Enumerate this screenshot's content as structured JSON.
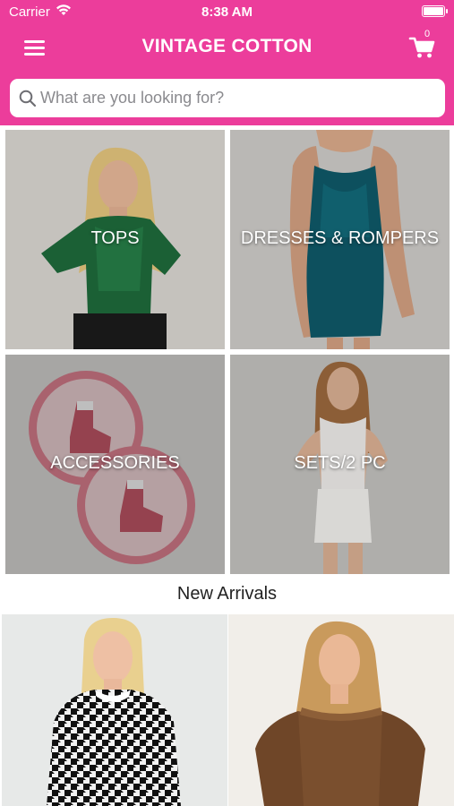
{
  "status_bar": {
    "carrier": "Carrier",
    "time": "8:38 AM"
  },
  "header": {
    "title": "VINTAGE COTTON",
    "cart_count": "0",
    "menu_icon": "hamburger-menu-icon",
    "cart_icon": "shopping-cart-icon"
  },
  "search": {
    "placeholder": "What are you looking for?",
    "value": "",
    "icon": "search-icon"
  },
  "categories": [
    {
      "label": "TOPS"
    },
    {
      "label": "DRESSES & ROMPERS"
    },
    {
      "label": "ACCESSORIES"
    },
    {
      "label": "SETS/2 PC"
    }
  ],
  "new_arrivals": {
    "title": "New Arrivals"
  },
  "colors": {
    "brand_pink": "#ec3d9b",
    "tile_overlay": "#7a7a7a"
  }
}
